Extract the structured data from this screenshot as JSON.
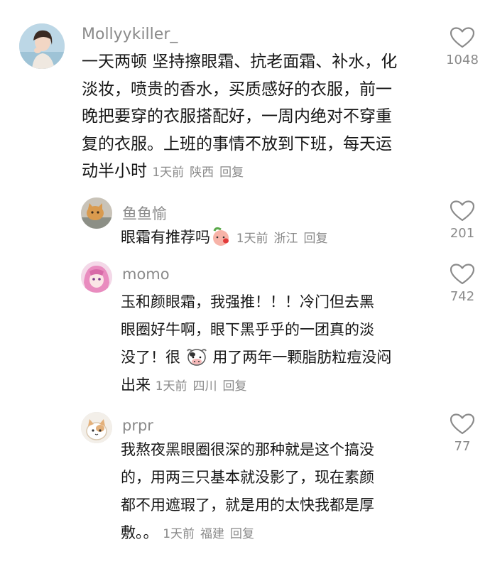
{
  "comments": [
    {
      "username": "Mollyykiller_",
      "avatar": "avatar-woman-photo",
      "lines": [
        "一天两顿 坚持擦眼霜、抗老面霜、补水，化",
        "淡妆，喷贵的香水，买质感好的衣服，前一",
        "晚把要穿的衣服搭配好，一周内绝对不穿重",
        "复的衣服。上班的事情不放到下班，每天运",
        "动半小时"
      ],
      "time": "1天前",
      "location": "陕西",
      "reply_label": "回复",
      "likes": "1048"
    },
    {
      "username": "鱼鱼愉",
      "avatar": "avatar-cat-orange",
      "lines": [
        "眼霜有推荐吗"
      ],
      "emoji": "peach-face-emoji",
      "time": "1天前",
      "location": "浙江",
      "reply_label": "回复",
      "likes": "201"
    },
    {
      "username": "momo",
      "avatar": "avatar-anime-pink",
      "lines": [
        "玉和颜眼霜，我强推！！！冷门但去黑",
        "眼圈好牛啊，眼下黑乎乎的一团真的淡",
        "没了！很",
        "出来"
      ],
      "line3_tail": "用了两年一颗脂肪粒痘没闷",
      "emoji": "cow-emoji",
      "time": "1天前",
      "location": "四川",
      "reply_label": "回复",
      "likes": "742"
    },
    {
      "username": "prpr",
      "avatar": "avatar-cat-cartoon",
      "lines": [
        "我熬夜黑眼圈很深的那种就是这个搞没",
        "的，用两三只基本就没影了，现在素颜",
        "都不用遮瑕了，就是用的太快我都是厚",
        "敷。。"
      ],
      "time": "1天前",
      "location": "福建",
      "reply_label": "回复",
      "likes": "77"
    }
  ],
  "watermark": "",
  "colors": {
    "meta_gray": "#8a8a8a",
    "text": "#161616",
    "background": "#ffffff"
  }
}
